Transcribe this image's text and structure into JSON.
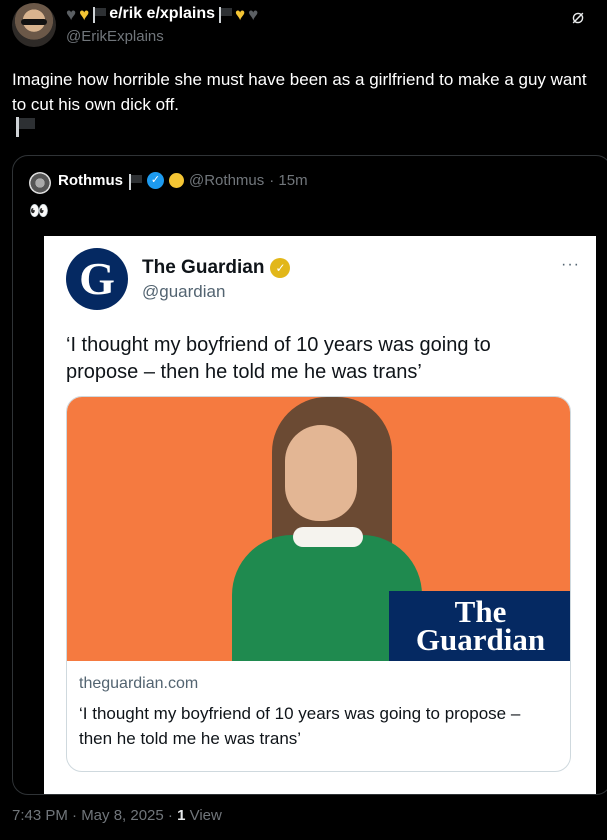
{
  "tweet": {
    "author_name": "e/rik e/xplains",
    "author_handle": "@ErikExplains",
    "text": "Imagine how horrible she must have been as a girlfriend to make a guy want to cut his own dick off.",
    "timestamp": "7:43 PM · May 8, 2025 · ",
    "views_count": "1",
    "views_label": "View"
  },
  "quoted": {
    "author_name": "Rothmus",
    "author_handle": "@Rothmus",
    "time_ago": "· 15m",
    "text": "👀"
  },
  "embedded": {
    "name": "The Guardian",
    "handle": "@guardian",
    "logo_letter": "G",
    "more": "···",
    "text": "‘I thought my boyfriend of 10 years was going to propose – then he told me he was trans’",
    "photo_logo_line1": "The",
    "photo_logo_line2": "Guardian",
    "link_domain": "theguardian.com",
    "link_title": "‘I thought my boyfriend of 10 years was going to propose – then he told me he was trans’"
  },
  "colors": {
    "background": "#000000",
    "guardian_blue": "#052962",
    "photo_orange": "#f57a40",
    "verified_blue": "#1d9bf0"
  },
  "icons": [
    "avatar",
    "heart-gray-icon",
    "heart-yellow-icon",
    "flag-icon",
    "grok-icon",
    "verified-icon",
    "gold-badge-icon",
    "eyes-emoji"
  ]
}
